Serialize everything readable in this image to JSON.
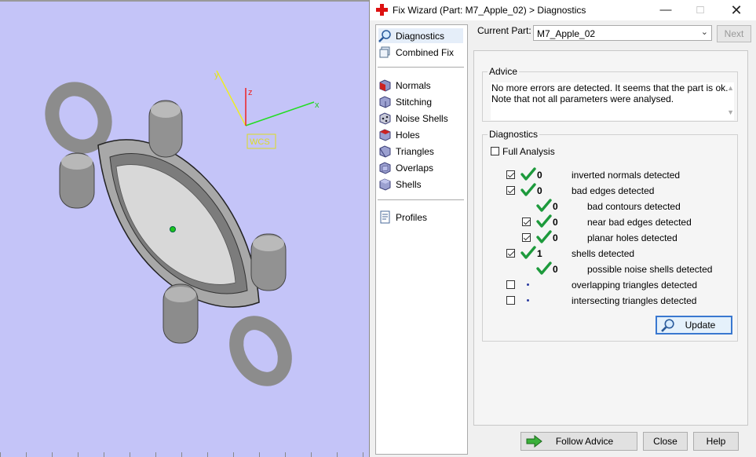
{
  "window": {
    "title": "Fix Wizard (Part: M7_Apple_02) > Diagnostics",
    "minimize_icon": "minimize-icon",
    "maximize_icon": "maximize-icon",
    "close_icon": "close-icon"
  },
  "viewport": {
    "axis_x": "x",
    "axis_y": "y",
    "axis_z": "z",
    "wcs_label": "WCS",
    "colors": {
      "background": "#c4c4f8",
      "x_axis": "#22dd22",
      "y_axis": "#eeee22",
      "z_axis": "#ee2222",
      "model": "#9a9a9a"
    }
  },
  "nav": {
    "items": [
      {
        "label": "Diagnostics",
        "icon": "diagnostics-magnifier-icon",
        "selected": true
      },
      {
        "label": "Combined Fix",
        "icon": "combined-fix-icon"
      },
      {
        "label": "Normals",
        "icon": "normals-cube-icon"
      },
      {
        "label": "Stitching",
        "icon": "stitching-cube-icon"
      },
      {
        "label": "Noise Shells",
        "icon": "noise-shells-icon"
      },
      {
        "label": "Holes",
        "icon": "holes-cube-icon"
      },
      {
        "label": "Triangles",
        "icon": "triangles-cube-icon"
      },
      {
        "label": "Overlaps",
        "icon": "overlaps-cube-icon"
      },
      {
        "label": "Shells",
        "icon": "shells-cube-icon"
      },
      {
        "label": "Profiles",
        "icon": "profiles-document-icon"
      }
    ]
  },
  "current_part": {
    "label": "Current Part:",
    "value": "M7_Apple_02",
    "next_label": "Next"
  },
  "advice": {
    "title": "Advice",
    "line1": "No more errors are detected. It seems that the part is ok.",
    "line2": "Note that not all parameters were analysed."
  },
  "diagnostics": {
    "title": "Diagnostics",
    "full_analysis_label": "Full Analysis",
    "full_analysis_checked": false,
    "rows": [
      {
        "checkbox": true,
        "checked": true,
        "status": "ok",
        "count": "0",
        "label": "inverted normals detected",
        "indent": 0
      },
      {
        "checkbox": true,
        "checked": true,
        "status": "ok",
        "count": "0",
        "label": "bad edges detected",
        "indent": 0
      },
      {
        "checkbox": false,
        "status": "ok",
        "count": "0",
        "label": "bad contours detected",
        "indent": 1
      },
      {
        "checkbox": true,
        "checked": true,
        "status": "ok",
        "count": "0",
        "label": "near bad edges detected",
        "indent": 1
      },
      {
        "checkbox": true,
        "checked": true,
        "status": "ok",
        "count": "0",
        "label": "planar holes detected",
        "indent": 1
      },
      {
        "checkbox": true,
        "checked": true,
        "status": "ok",
        "count": "1",
        "label": "shells detected",
        "indent": 0
      },
      {
        "checkbox": false,
        "status": "ok",
        "count": "0",
        "label": "possible noise shells detected",
        "indent": 1
      },
      {
        "checkbox": true,
        "checked": false,
        "status": "not-run",
        "count": "",
        "label": "overlapping triangles detected",
        "indent": 0
      },
      {
        "checkbox": true,
        "checked": false,
        "status": "not-run",
        "count": "",
        "label": "intersecting triangles detected",
        "indent": 0
      }
    ],
    "update_label": "Update"
  },
  "footer": {
    "follow_advice_label": "Follow Advice",
    "close_label": "Close",
    "help_label": "Help"
  }
}
